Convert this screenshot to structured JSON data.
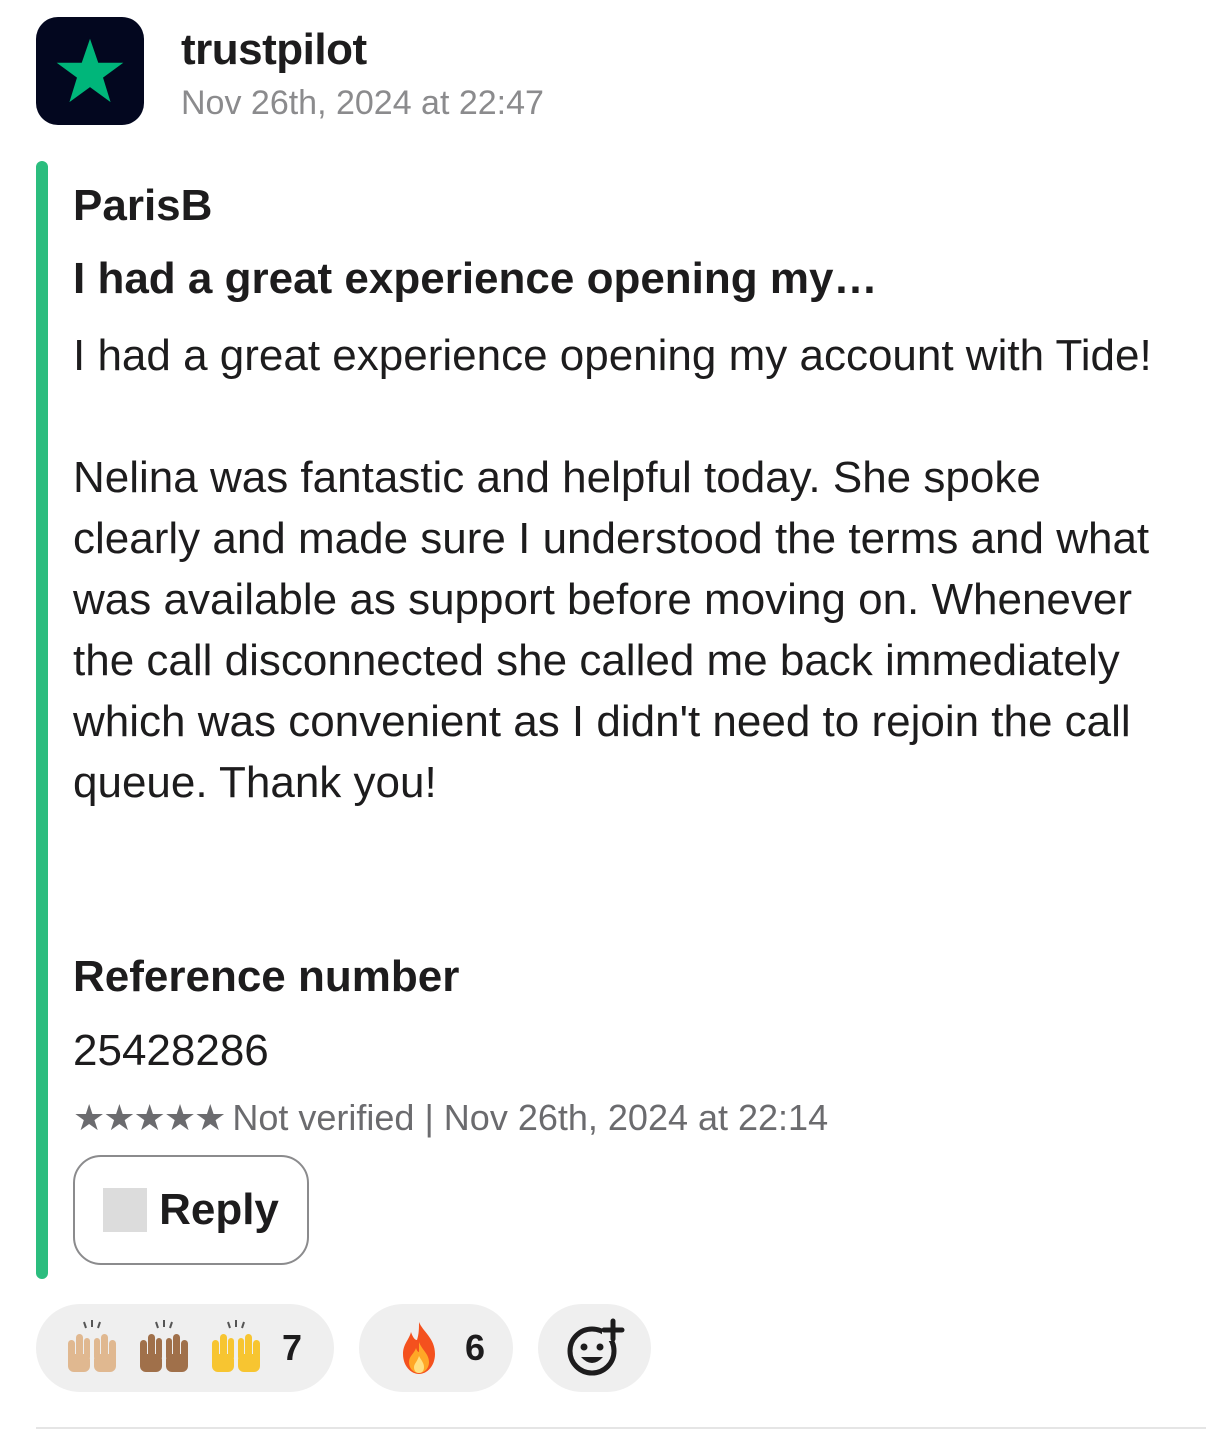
{
  "message": {
    "app_name": "trustpilot",
    "timestamp": "Nov 26th, 2024 at 22:47",
    "avatar_icon": "trustpilot-star-icon",
    "accent_color": "#2bbd7e",
    "avatar_bg": "#03071f",
    "star_color": "#00b67a"
  },
  "review": {
    "author": "ParisB",
    "title": "I had a great experience opening my…",
    "body_paragraph_1": "I had a great experience opening my account with Tide!",
    "body_paragraph_2": "Nelina was fantastic and helpful today. She spoke clearly and made sure I understood the terms and what was available as support before moving on. Whenever the call disconnected she called me back immediately which was convenient as I didn't need to rejoin the call queue. Thank you!",
    "reference_label": "Reference number",
    "reference_value": "25428286",
    "stars": "★★★★★",
    "rating": 5,
    "meta": "Not verified | Nov 26th, 2024 at 22:14"
  },
  "actions": {
    "reply_label": "Reply"
  },
  "reactions": [
    {
      "icon": "raised-hands-emoji",
      "count": "7"
    },
    {
      "icon": "fire-emoji",
      "count": "6"
    },
    {
      "icon": "add-reaction-icon"
    }
  ]
}
